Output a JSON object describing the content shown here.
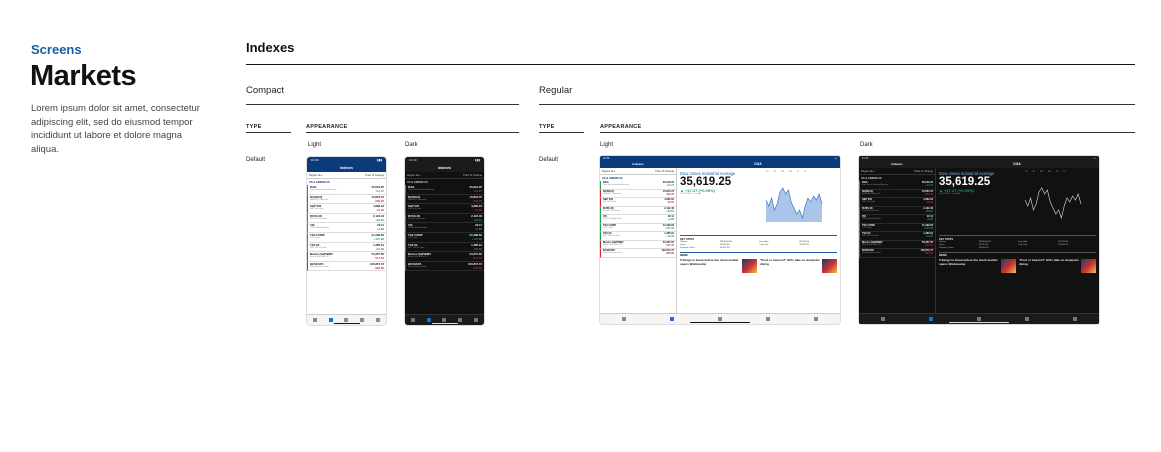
{
  "header": {
    "eyebrow": "Screens",
    "title": "Markets",
    "description": "Lorem ipsum dolor sit amet, consectetur adipiscing elit, sed do eiusmod tempor incididunt ut labore et dolore magna aliqua."
  },
  "section": {
    "title": "Indexes"
  },
  "compact": {
    "title": "Compact",
    "type_header": "TYPE",
    "appearance_header": "APPEARANCE",
    "row_label": "Default",
    "light_label": "Light",
    "dark_label": "Dark"
  },
  "regular": {
    "title": "Regular",
    "type_header": "TYPE",
    "appearance_header": "APPEARANCE",
    "row_label": "Default",
    "light_label": "Light",
    "dark_label": "Dark"
  },
  "phone": {
    "time": "10:30",
    "nav_title": "Indexes",
    "filter_region": "Region",
    "filter_all": "ALL",
    "filter_price": "Price",
    "filter_change": "% Change",
    "section_label": "US & AMERICAS",
    "rows": [
      {
        "name": "DJIA",
        "sub": "Dow Jones Industrial Average",
        "value": "35,619.25",
        "change": "+17.27",
        "pct": "+0.05%",
        "dir": "up"
      },
      {
        "name": "NASDAQ",
        "sub": "NASDAQ Composite",
        "value": "15,854.76",
        "change": "-202.20",
        "pct": "-1.26%",
        "dir": "down"
      },
      {
        "name": "S&P 500",
        "sub": "S&P 500 Index",
        "value": "4,682.94",
        "change": "-15.02",
        "pct": "-0.32%",
        "dir": "down"
      },
      {
        "name": "RUSS 2K",
        "sub": "Russell 2000 Index",
        "value": "2,122.46",
        "change": "+26.81",
        "pct": "+1.28%",
        "dir": "up"
      },
      {
        "name": "VIX",
        "sub": "CBOE Volatility Index",
        "value": "22.11",
        "change": "+2.86",
        "pct": "+14.86%",
        "dir": "up"
      },
      {
        "name": "TSX COMP",
        "sub": "TSX Comp",
        "value": "21,298.63",
        "change": "+127.96",
        "pct": "+0.60%",
        "dir": "up"
      },
      {
        "name": "TSX 60",
        "sub": "S&P TSX 60 Index",
        "value": "1,285.91",
        "change": "+10.36",
        "pct": "+0.81%",
        "dir": "up"
      },
      {
        "name": "Mexico S&P/BMV",
        "sub": "Mexico S&P/BMV IPC",
        "value": "53,357.60",
        "change": "-517.16",
        "pct": "-0.96%",
        "dir": "down"
      },
      {
        "name": "BOVESPA",
        "sub": "Brazil Bovespa Index",
        "value": "106,872.73",
        "change": "-995.85",
        "pct": "-0.92%",
        "dir": "down"
      }
    ],
    "tabs": [
      "Home",
      "Markets",
      "Watchlist",
      "Video",
      "Listen"
    ]
  },
  "tablet": {
    "nav_title": "Indexes",
    "detail_title": "DJIA",
    "index_name": "Dow Jones Industrial Average",
    "index_value": "35,619.25",
    "index_change": "▲ +17.27 (+0.05%)",
    "timestamp": "4:30 PM EST · Delayed",
    "range_tabs": [
      "1D",
      "5D",
      "1M",
      "3M",
      "1Y",
      "5Y"
    ],
    "key_stats_title": "KEY STATS",
    "key_stats": [
      {
        "label": "Volume",
        "value": "298,840,205"
      },
      {
        "label": "Day High",
        "value": "35,876.56"
      },
      {
        "label": "Open",
        "value": "35,622.66"
      },
      {
        "label": "Day Low",
        "value": "35,487.25"
      },
      {
        "label": "Previous Close",
        "value": "35,601.98"
      }
    ],
    "news_title": "NEWS",
    "news": [
      {
        "headline": "5 things to know before the stock market opens Wednesday"
      },
      {
        "headline": "'Trust or treason?' Hill's take on dumpster diving"
      }
    ]
  }
}
